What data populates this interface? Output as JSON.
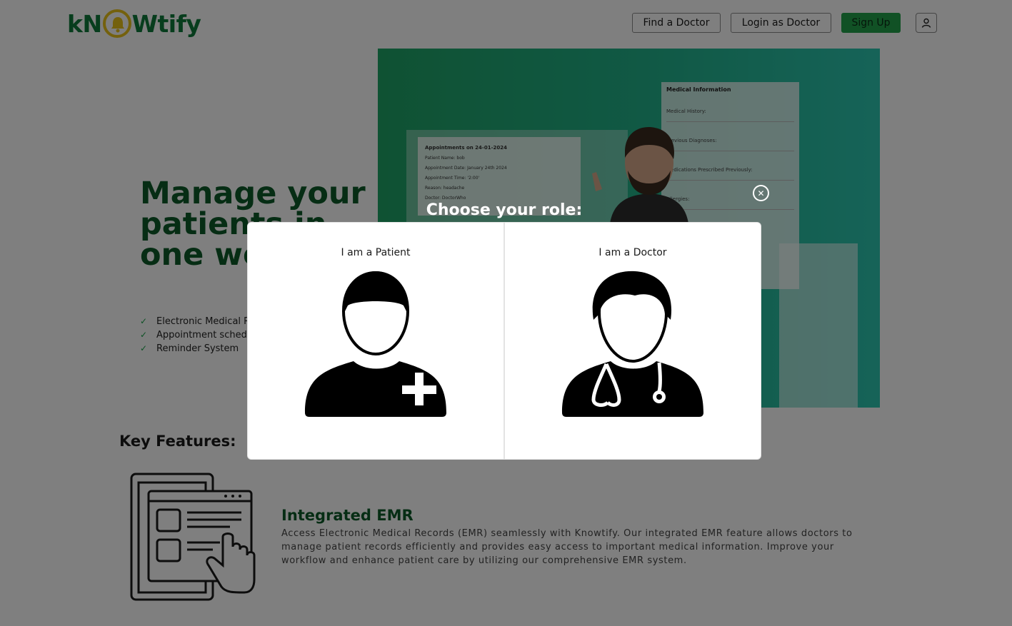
{
  "header": {
    "logo_prefix": "kN",
    "logo_suffix": "Wtify",
    "nav": {
      "find_doctor": "Find a Doctor",
      "login_doctor": "Login as Doctor",
      "sign_up": "Sign Up"
    }
  },
  "hero": {
    "title": "Manage your patients in one website",
    "features": [
      "Electronic Medical Records",
      "Appointment scheduling",
      "Reminder System"
    ],
    "image": {
      "appointments_title": "Appointments on 24-01-2024",
      "appointment_lines": [
        "Patient Name: bob",
        "Appointment Date: January 24th 2024",
        "Appointment Time: '2:00'",
        "Reason: headache",
        "Doctor: DoctorWho"
      ],
      "medical_info_title": "Medical Information",
      "medical_info_fields": [
        "Medical History:",
        "Previous Diagnoses:",
        "Medications Prescribed Previously:",
        "Allergies:"
      ]
    }
  },
  "key_features": {
    "title": "Key Features:",
    "emr": {
      "title": "Integrated EMR",
      "description": "Access Electronic Medical Records (EMR) seamlessly with Knowtify. Our integrated EMR feature allows doctors to manage patient records efficiently and provides easy access to important medical information. Improve your workflow and enhance patient care by utilizing our comprehensive EMR system."
    }
  },
  "modal": {
    "title": "Choose your role:",
    "roles": [
      {
        "label": "I am a Patient",
        "icon": "patient-icon"
      },
      {
        "label": "I am a Doctor",
        "icon": "doctor-icon"
      }
    ]
  },
  "colors": {
    "brand_green": "#0c5a28",
    "accent_green": "#23a24a",
    "logo_ring": "#e8c21a"
  }
}
